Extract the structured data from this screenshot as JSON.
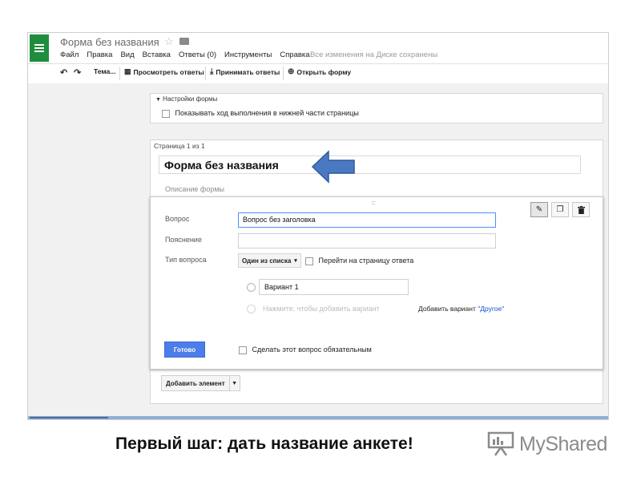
{
  "app": {
    "doc_title": "Форма без названия",
    "menu": [
      "Файл",
      "Правка",
      "Вид",
      "Вставка",
      "Ответы (0)",
      "Инструменты",
      "Справка"
    ],
    "save_status": "Все изменения на Диске сохранены"
  },
  "toolbar": {
    "theme_label": "Тема...",
    "view_responses_label": "Просмотреть ответы",
    "accepting_responses_label": "Принимать ответы",
    "open_form_label": "Открыть форму"
  },
  "settings": {
    "title": "Настройки формы",
    "progress_label": "Показывать ход выполнения в нижней части страницы",
    "progress_checked": false
  },
  "page": {
    "label": "Страница 1 из 1",
    "form_title": "Форма без названия",
    "description_placeholder": "Описание формы"
  },
  "question": {
    "question_label": "Вопрос",
    "question_value": "Вопрос без заголовка",
    "help_label": "Пояснение",
    "help_value": "",
    "type_label": "Тип вопроса",
    "type_value": "Один из списка",
    "goto_page_label": "Перейти на страницу ответа",
    "option1_value": "Вариант 1",
    "add_option_hint": "Нажмите, чтобы добавить вариант",
    "add_other_prefix": "Добавить вариант ",
    "add_other_link": "\"Другое\"",
    "done_label": "Готово",
    "required_label": "Сделать этот вопрос обязательным"
  },
  "add_element_label": "Добавить элемент",
  "caption": "Первый шаг: дать название анкете!",
  "watermark": "MyShared",
  "colors": {
    "logo_green": "#1e8e3e",
    "done_button_blue": "#4d7de8",
    "arrow_blue": "#4a78c2",
    "link_blue": "#1155cc"
  },
  "icons": {
    "undo": "undo-icon",
    "redo": "redo-icon",
    "edit": "pencil-icon",
    "duplicate": "copy-icon",
    "delete": "trash-icon",
    "star": "star-icon",
    "folder": "folder-icon"
  }
}
